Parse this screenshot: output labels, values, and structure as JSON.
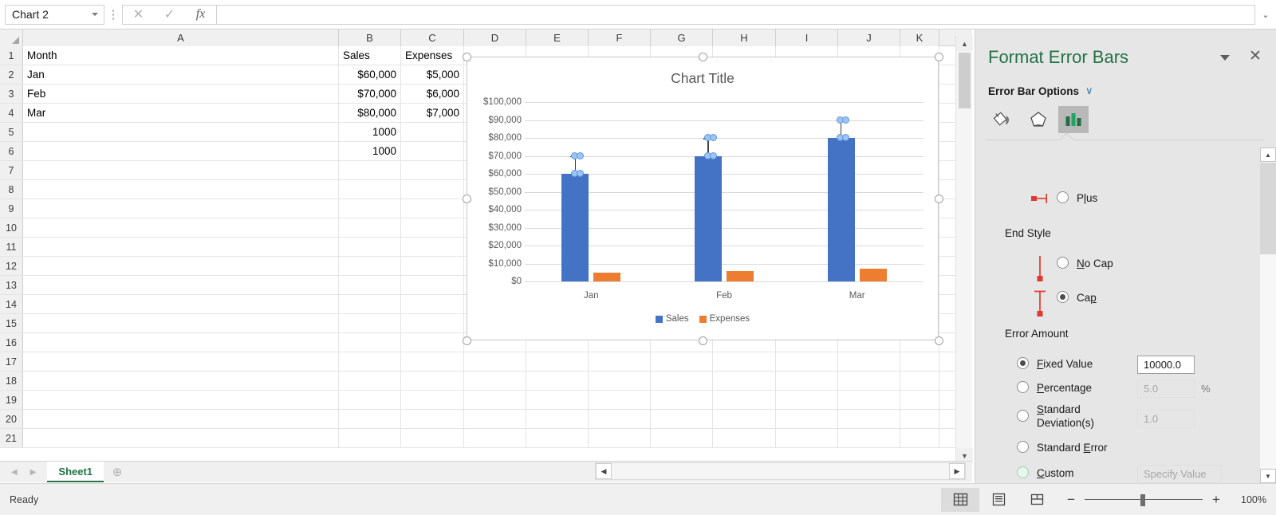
{
  "formula_bar": {
    "name_box_value": "Chart 2",
    "grip": "⋮",
    "cancel_icon": "✕",
    "enter_icon": "✓",
    "fx_icon": "fx",
    "formula_value": "",
    "expand_icon": "⌄"
  },
  "grid": {
    "column_headers": [
      "A",
      "B",
      "C",
      "D",
      "E",
      "F",
      "G",
      "H",
      "I",
      "J",
      "K"
    ],
    "row_headers": [
      "1",
      "2",
      "3",
      "4",
      "5",
      "6",
      "7",
      "8",
      "9",
      "10",
      "11",
      "12",
      "13",
      "14",
      "15",
      "16",
      "17",
      "18",
      "19",
      "20",
      "21"
    ],
    "data": [
      {
        "row": "1",
        "A": "Month",
        "B": "Sales",
        "C": "Expenses"
      },
      {
        "row": "2",
        "A": "Jan",
        "B": "$60,000",
        "C": "$5,000"
      },
      {
        "row": "3",
        "A": "Feb",
        "B": "$70,000",
        "C": "$6,000"
      },
      {
        "row": "4",
        "A": "Mar",
        "B": "$80,000",
        "C": "$7,000"
      },
      {
        "row": "5",
        "A": "",
        "B": "1000",
        "C": ""
      },
      {
        "row": "6",
        "A": "",
        "B": "1000",
        "C": ""
      }
    ]
  },
  "chart_data": {
    "type": "bar",
    "title": "Chart Title",
    "categories": [
      "Jan",
      "Feb",
      "Mar"
    ],
    "series": [
      {
        "name": "Sales",
        "values": [
          60000,
          70000,
          80000
        ],
        "color": "#4472c4"
      },
      {
        "name": "Expenses",
        "values": [
          5000,
          6000,
          7000
        ],
        "color": "#ed7d31"
      }
    ],
    "error_bars": {
      "series": "Sales",
      "direction": "Plus",
      "end_style": "Cap",
      "amount_type": "Fixed Value",
      "fixed_value": 10000,
      "tops": [
        70000,
        80000,
        90000
      ],
      "selected": true
    },
    "ylim": [
      0,
      100000
    ],
    "ytick_labels": [
      "$0",
      "$10,000",
      "$20,000",
      "$30,000",
      "$40,000",
      "$50,000",
      "$60,000",
      "$70,000",
      "$80,000",
      "$90,000",
      "$100,000"
    ],
    "ytick_values": [
      0,
      10000,
      20000,
      30000,
      40000,
      50000,
      60000,
      70000,
      80000,
      90000,
      100000
    ],
    "xlabel": "",
    "ylabel": "",
    "grid": true,
    "legend_position": "bottom"
  },
  "task_pane": {
    "title": "Format Error Bars",
    "caret_icon": "chevron-down",
    "close_icon": "✕",
    "subtitle": "Error Bar Options",
    "subtitle_chevron": "∨",
    "tabs": [
      {
        "name": "fill-line-icon",
        "selected": false
      },
      {
        "name": "effects-icon",
        "selected": false
      },
      {
        "name": "error-bar-options-icon",
        "selected": true
      }
    ],
    "direction_options": [
      {
        "label": "Plus",
        "accel": "l",
        "checked": false
      }
    ],
    "end_style_label": "End Style",
    "end_style_options": [
      {
        "label": "No Cap",
        "accel": "N",
        "checked": false
      },
      {
        "label": "Cap",
        "accel": "p",
        "checked": true
      }
    ],
    "error_amount_label": "Error Amount",
    "error_amount_options": [
      {
        "label": "Fixed Value",
        "checked": true,
        "value": "10000.0",
        "disabled": false,
        "suffix": ""
      },
      {
        "label": "Percentage",
        "checked": false,
        "value": "5.0",
        "disabled": true,
        "suffix": "%"
      },
      {
        "label": "Standard Deviation(s)",
        "checked": false,
        "value": "1.0",
        "disabled": true,
        "suffix": ""
      },
      {
        "label": "Standard Error",
        "checked": false,
        "value": "",
        "disabled": true,
        "suffix": ""
      },
      {
        "label": "Custom",
        "checked": false,
        "value": "Specify Value",
        "disabled": true,
        "suffix": ""
      }
    ]
  },
  "sheet_tabs": {
    "prev_icon": "◀",
    "next_icon": "▶",
    "tabs": [
      {
        "label": "Sheet1",
        "active": true
      }
    ],
    "add_icon": "⊕",
    "grip_icon": "⋮"
  },
  "h_scroll": {
    "left_icon": "◀",
    "right_icon": "▶"
  },
  "v_scroll": {
    "up_icon": "▲",
    "down_icon": "▼"
  },
  "status_bar": {
    "status_text": "Ready",
    "view_buttons": [
      {
        "name": "normal-view",
        "active": true
      },
      {
        "name": "page-layout-view",
        "active": false
      },
      {
        "name": "page-break-preview",
        "active": false
      }
    ],
    "zoom_out_icon": "−",
    "zoom_in_icon": "+",
    "zoom_level": "100%"
  }
}
